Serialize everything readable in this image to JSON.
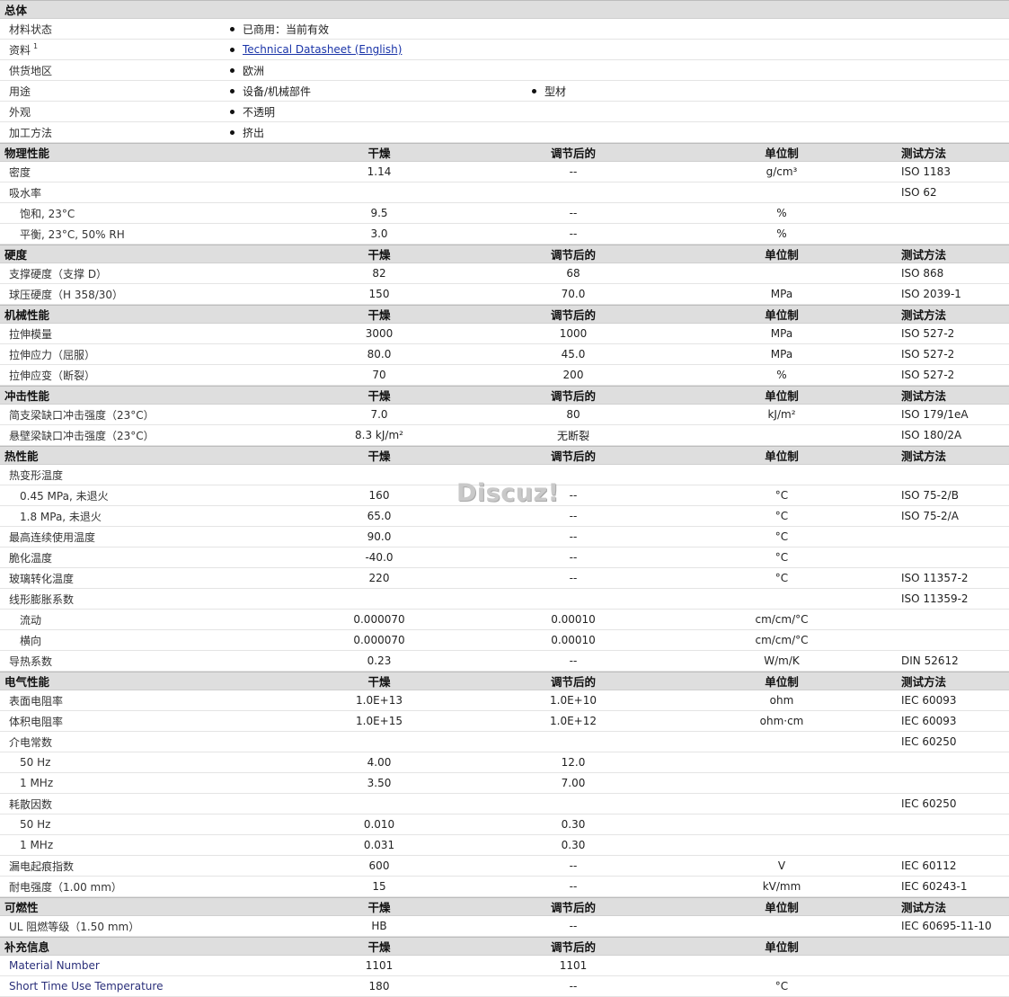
{
  "general": {
    "title": "总体",
    "rows": [
      {
        "label": "材料状态",
        "items": [
          "已商用：当前有效"
        ]
      },
      {
        "label": "资料",
        "sup": "1",
        "link": "Technical Datasheet (English)"
      },
      {
        "label": "供货地区",
        "items": [
          "欧洲"
        ]
      },
      {
        "label": "用途",
        "items": [
          "设备/机械部件",
          "型材"
        ]
      },
      {
        "label": "外观",
        "items": [
          "不透明"
        ]
      },
      {
        "label": "加工方法",
        "items": [
          "挤出"
        ]
      }
    ]
  },
  "sections": [
    {
      "title": "物理性能",
      "cols": [
        "干燥",
        "调节后的",
        "单位制",
        "测试方法"
      ],
      "rows": [
        {
          "label": "密度",
          "dry": "1.14",
          "cond": "--",
          "unit": "g/cm³",
          "test": "ISO 1183"
        },
        {
          "label": "吸水率",
          "dry": "",
          "cond": "",
          "unit": "",
          "test": "ISO 62"
        },
        {
          "label": "饱和, 23°C",
          "indent": true,
          "dry": "9.5",
          "cond": "--",
          "unit": "%",
          "test": ""
        },
        {
          "label": "平衡, 23°C, 50% RH",
          "indent": true,
          "dry": "3.0",
          "cond": "--",
          "unit": "%",
          "test": ""
        }
      ]
    },
    {
      "title": "硬度",
      "cols": [
        "干燥",
        "调节后的",
        "单位制",
        "测试方法"
      ],
      "rows": [
        {
          "label": "支撑硬度（支撑 D）",
          "dry": "82",
          "cond": "68",
          "unit": "",
          "test": "ISO 868"
        },
        {
          "label": "球压硬度（H 358/30）",
          "dry": "150",
          "cond": "70.0",
          "unit": "MPa",
          "test": "ISO 2039-1"
        }
      ]
    },
    {
      "title": "机械性能",
      "cols": [
        "干燥",
        "调节后的",
        "单位制",
        "测试方法"
      ],
      "rows": [
        {
          "label": "拉伸模量",
          "dry": "3000",
          "cond": "1000",
          "unit": "MPa",
          "test": "ISO 527-2"
        },
        {
          "label": "拉伸应力（屈服）",
          "dry": "80.0",
          "cond": "45.0",
          "unit": "MPa",
          "test": "ISO 527-2"
        },
        {
          "label": "拉伸应变（断裂）",
          "dry": "70",
          "cond": "200",
          "unit": "%",
          "test": "ISO 527-2"
        }
      ]
    },
    {
      "title": "冲击性能",
      "cols": [
        "干燥",
        "调节后的",
        "单位制",
        "测试方法"
      ],
      "rows": [
        {
          "label": "简支梁缺口冲击强度（23°C）",
          "dry": "7.0",
          "cond": "80",
          "unit": "kJ/m²",
          "test": "ISO 179/1eA"
        },
        {
          "label": "悬壁梁缺口冲击强度（23°C）",
          "dry": "8.3 kJ/m²",
          "cond": "无断裂",
          "unit": "",
          "test": "ISO 180/2A"
        }
      ]
    },
    {
      "title": "热性能",
      "cols": [
        "干燥",
        "调节后的",
        "单位制",
        "测试方法"
      ],
      "rows": [
        {
          "label": "热变形温度",
          "dry": "",
          "cond": "",
          "unit": "",
          "test": ""
        },
        {
          "label": "0.45 MPa, 未退火",
          "indent": true,
          "dry": "160",
          "cond": "--",
          "unit": "°C",
          "test": "ISO 75-2/B"
        },
        {
          "label": "1.8 MPa, 未退火",
          "indent": true,
          "dry": "65.0",
          "cond": "--",
          "unit": "°C",
          "test": "ISO 75-2/A"
        },
        {
          "label": "最高连续使用温度",
          "dry": "90.0",
          "cond": "--",
          "unit": "°C",
          "test": ""
        },
        {
          "label": "脆化温度",
          "dry": "-40.0",
          "cond": "--",
          "unit": "°C",
          "test": ""
        },
        {
          "label": "玻璃转化温度",
          "dry": "220",
          "cond": "--",
          "unit": "°C",
          "test": "ISO 11357-2"
        },
        {
          "label": "线形膨胀系数",
          "dry": "",
          "cond": "",
          "unit": "",
          "test": "ISO 11359-2"
        },
        {
          "label": "流动",
          "indent": true,
          "dry": "0.000070",
          "cond": "0.00010",
          "unit": "cm/cm/°C",
          "test": ""
        },
        {
          "label": "横向",
          "indent": true,
          "dry": "0.000070",
          "cond": "0.00010",
          "unit": "cm/cm/°C",
          "test": ""
        },
        {
          "label": "导热系数",
          "dry": "0.23",
          "cond": "--",
          "unit": "W/m/K",
          "test": "DIN 52612"
        }
      ]
    },
    {
      "title": "电气性能",
      "cols": [
        "干燥",
        "调节后的",
        "单位制",
        "测试方法"
      ],
      "rows": [
        {
          "label": "表面电阻率",
          "dry": "1.0E+13",
          "cond": "1.0E+10",
          "unit": "ohm",
          "test": "IEC 60093"
        },
        {
          "label": "体积电阻率",
          "dry": "1.0E+15",
          "cond": "1.0E+12",
          "unit": "ohm·cm",
          "test": "IEC 60093"
        },
        {
          "label": "介电常数",
          "dry": "",
          "cond": "",
          "unit": "",
          "test": "IEC 60250"
        },
        {
          "label": "50 Hz",
          "indent": true,
          "dry": "4.00",
          "cond": "12.0",
          "unit": "",
          "test": ""
        },
        {
          "label": "1 MHz",
          "indent": true,
          "dry": "3.50",
          "cond": "7.00",
          "unit": "",
          "test": ""
        },
        {
          "label": "耗散因数",
          "dry": "",
          "cond": "",
          "unit": "",
          "test": "IEC 60250"
        },
        {
          "label": "50 Hz",
          "indent": true,
          "dry": "0.010",
          "cond": "0.30",
          "unit": "",
          "test": ""
        },
        {
          "label": "1 MHz",
          "indent": true,
          "dry": "0.031",
          "cond": "0.30",
          "unit": "",
          "test": ""
        },
        {
          "label": "漏电起痕指数",
          "dry": "600",
          "cond": "--",
          "unit": "V",
          "test": "IEC 60112"
        },
        {
          "label": "耐电强度（1.00 mm）",
          "dry": "15",
          "cond": "--",
          "unit": "kV/mm",
          "test": "IEC 60243-1"
        }
      ]
    },
    {
      "title": "可燃性",
      "cols": [
        "干燥",
        "调节后的",
        "单位制",
        "测试方法"
      ],
      "rows": [
        {
          "label": "UL 阻燃等级（1.50 mm）",
          "dry": "HB",
          "cond": "--",
          "unit": "",
          "test": "IEC 60695-11-10"
        }
      ]
    },
    {
      "title": "补充信息",
      "cols": [
        "干燥",
        "调节后的",
        "单位制",
        ""
      ],
      "rows": [
        {
          "label": "Material Number",
          "navy": true,
          "dry": "1101",
          "cond": "1101",
          "unit": "",
          "test": ""
        },
        {
          "label": "Short Time Use Temperature",
          "navy": true,
          "dry": "180",
          "cond": "--",
          "unit": "°C",
          "test": ""
        }
      ]
    }
  ],
  "watermark": "Discuz!"
}
